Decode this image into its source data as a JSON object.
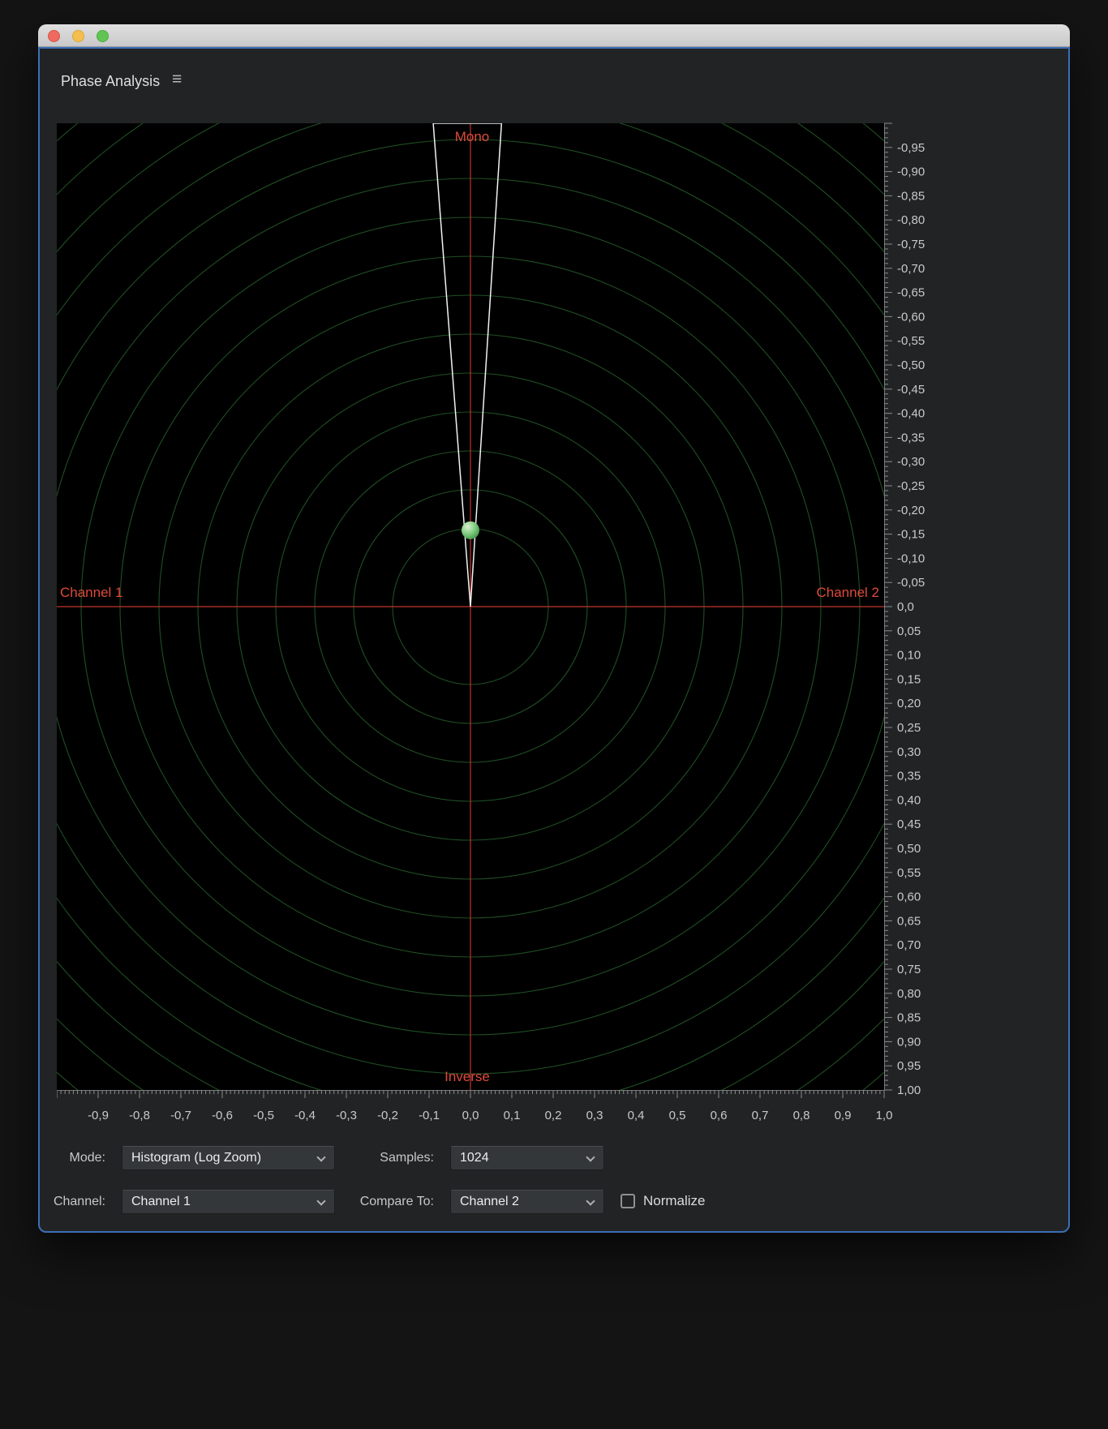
{
  "window": {
    "panel_title": "Phase Analysis",
    "titlebar_buttons": [
      "close",
      "minimize",
      "zoom"
    ]
  },
  "controls": {
    "mode": {
      "label": "Mode:",
      "value": "Histogram (Log Zoom)"
    },
    "samples": {
      "label": "Samples:",
      "value": "1024"
    },
    "channel": {
      "label": "Channel:",
      "value": "Channel 1"
    },
    "compare_to": {
      "label": "Compare To:",
      "value": "Channel 2"
    },
    "normalize": {
      "label": "Normalize",
      "checked": false
    }
  },
  "chart_data": {
    "type": "scatter",
    "title": "Phase Analysis",
    "mode": "Histogram (Log Zoom)",
    "axis_labels": {
      "top": "Mono",
      "bottom": "Inverse",
      "left": "Channel 1",
      "right": "Channel 2"
    },
    "x_axis": {
      "range": [
        -1.0,
        1.0
      ],
      "tick_step": 0.1,
      "tick_labels": [
        "-0,9",
        "-0,8",
        "-0,7",
        "-0,6",
        "-0,5",
        "-0,4",
        "-0,3",
        "-0,2",
        "-0,1",
        "0,0",
        "0,1",
        "0,2",
        "0,3",
        "0,4",
        "0,5",
        "0,6",
        "0,7",
        "0,8",
        "0,9",
        "1,0"
      ]
    },
    "y_axis": {
      "range": [
        -1.0,
        1.0
      ],
      "tick_step": 0.05,
      "tick_labels": [
        "-0,95",
        "-0,90",
        "-0,85",
        "-0,80",
        "-0,75",
        "-0,70",
        "-0,65",
        "-0,60",
        "-0,55",
        "-0,50",
        "-0,45",
        "-0,40",
        "-0,35",
        "-0,30",
        "-0,25",
        "-0,20",
        "-0,15",
        "-0,10",
        "-0,05",
        "0,0",
        "0,05",
        "0,10",
        "0,15",
        "0,20",
        "0,25",
        "0,30",
        "0,35",
        "0,40",
        "0,45",
        "0,50",
        "0,55",
        "0,60",
        "0,65",
        "0,70",
        "0,75",
        "0,80",
        "0,85",
        "0,90",
        "0,95",
        "1,00"
      ]
    },
    "grid": {
      "style": "concentric_circles",
      "spacing_px": 48,
      "color": "#1f4f23"
    },
    "colors": {
      "background": "#000000",
      "axis": "#c2332e",
      "axis_label": "#de4a3a",
      "tick": "#8a8a8a",
      "tick_label": "#c9c9c9",
      "wedge": "#f2f2f2"
    },
    "histogram_wedge": {
      "apex": [
        0.0,
        0.0
      ],
      "top_left": [
        -0.09,
        -1.0
      ],
      "top_right": [
        0.075,
        -1.0
      ]
    },
    "ball": {
      "x": 0.0,
      "y": -0.158,
      "radius_px": 11,
      "color": "#7cc87c"
    }
  }
}
